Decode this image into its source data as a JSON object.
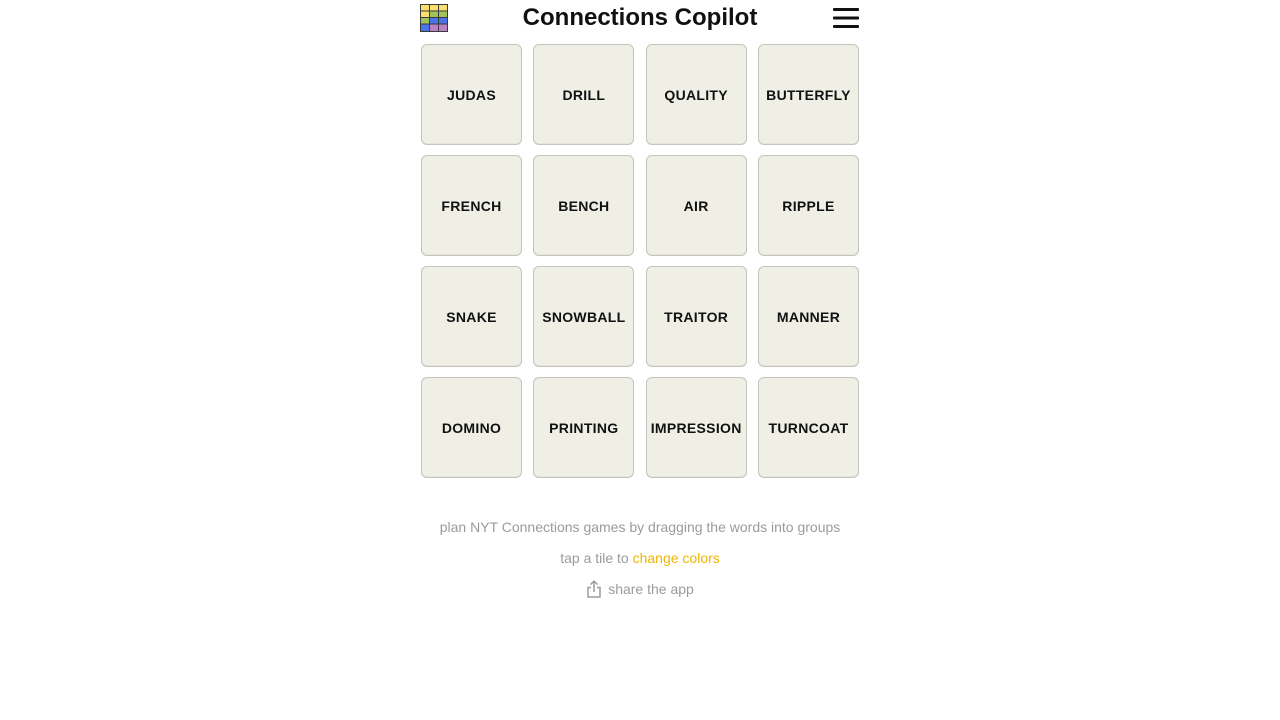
{
  "header": {
    "title": "Connections Copilot",
    "logo_icon": "color-grid-logo-icon",
    "menu_icon": "hamburger-menu-icon"
  },
  "tiles": [
    "JUDAS",
    "DRILL",
    "QUALITY",
    "BUTTERFLY",
    "FRENCH",
    "BENCH",
    "AIR",
    "RIPPLE",
    "SNAKE",
    "SNOWBALL",
    "TRAITOR",
    "MANNER",
    "DOMINO",
    "PRINTING",
    "IMPRESSION",
    "TURNCOAT"
  ],
  "footer": {
    "instructions": "plan NYT Connections games by dragging the words into groups",
    "tap_prefix": "tap a tile to ",
    "tap_link": "change colors",
    "share_label": "share the app",
    "share_icon": "share-icon"
  },
  "colors": {
    "tile_bg": "#efefe6",
    "accent": "#f0b400",
    "footer_text": "#9b9b9b",
    "logo_yellow": "#f9df6d",
    "logo_green": "#a0c35a",
    "logo_blue": "#4a74e8",
    "logo_purple": "#ba81c5"
  }
}
